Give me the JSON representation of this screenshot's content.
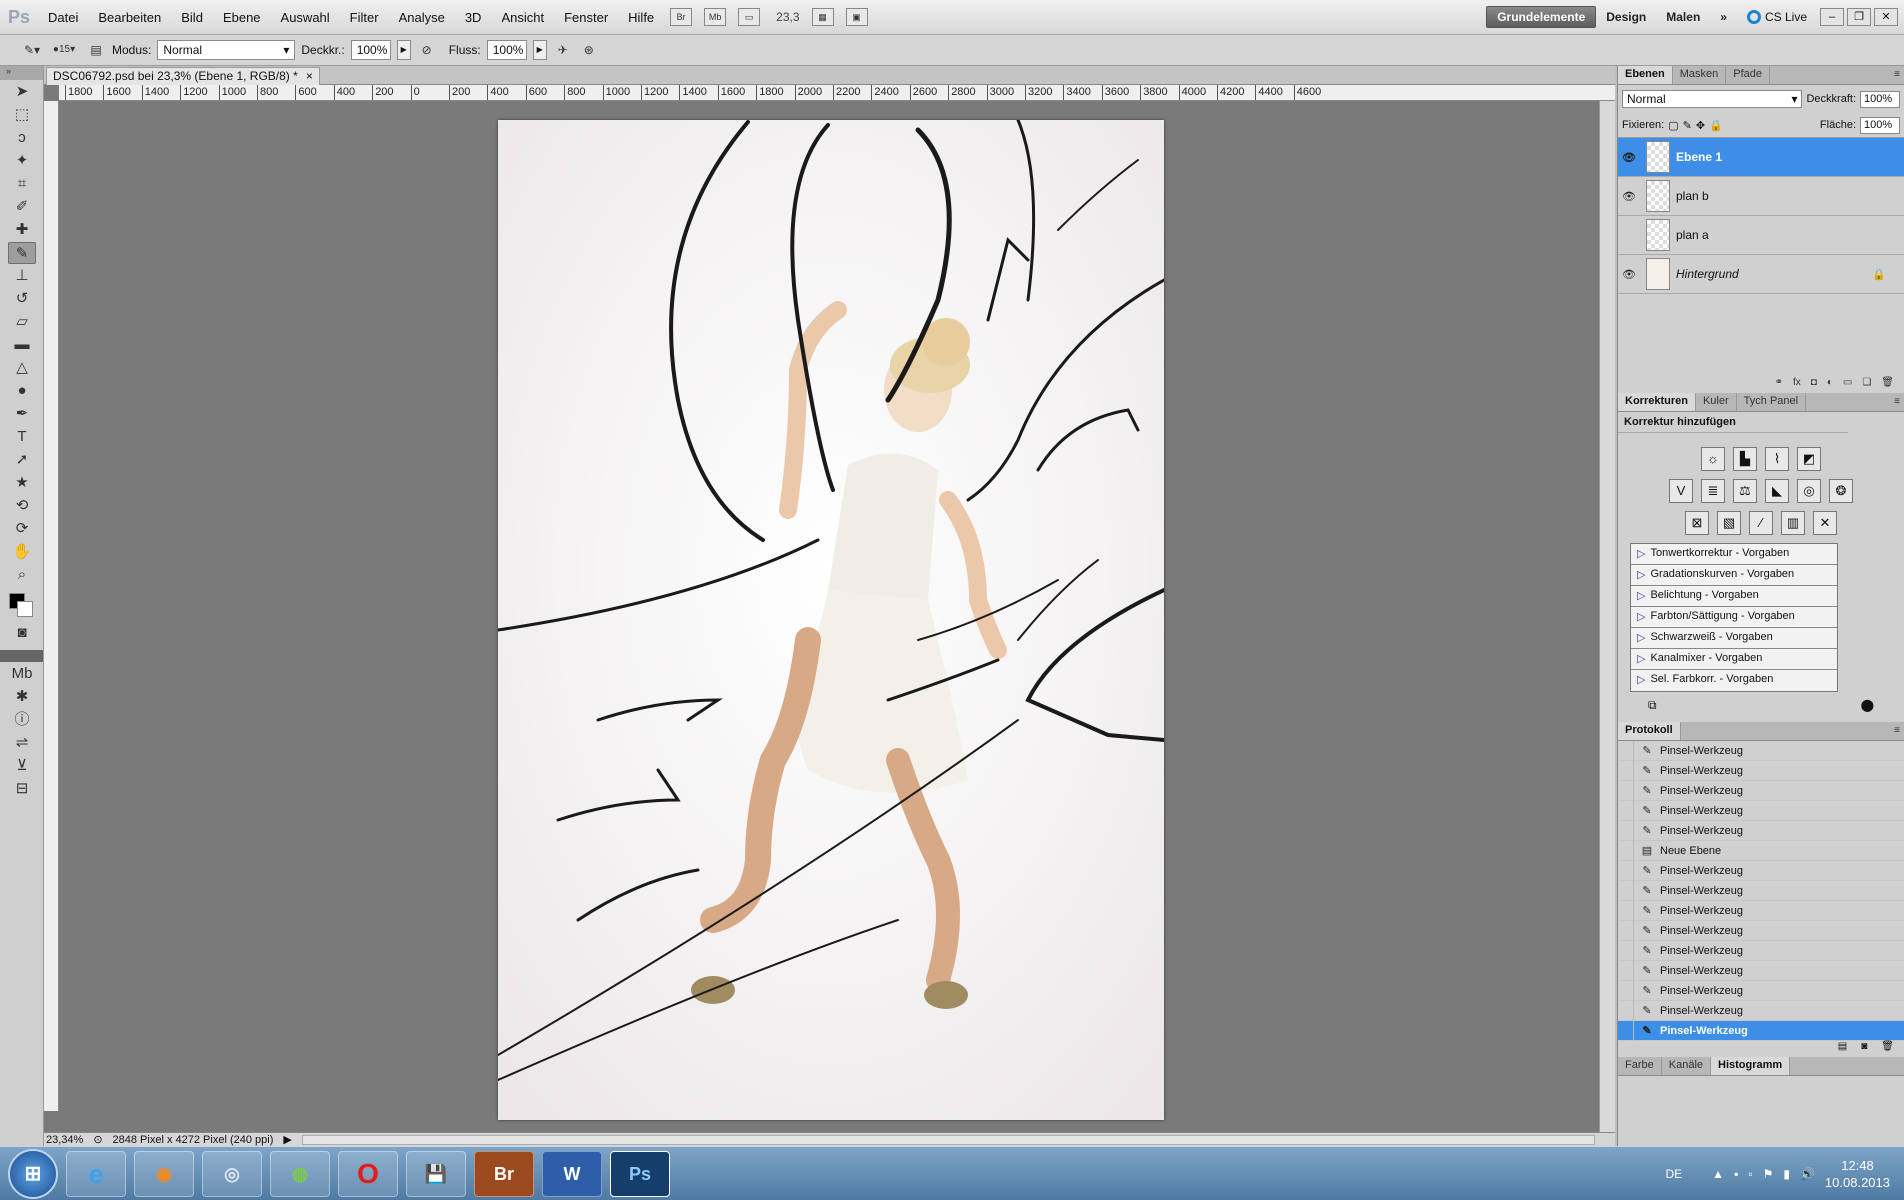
{
  "menubar": {
    "items": [
      "Datei",
      "Bearbeiten",
      "Bild",
      "Ebene",
      "Auswahl",
      "Filter",
      "Analyse",
      "3D",
      "Ansicht",
      "Fenster",
      "Hilfe"
    ],
    "br": "Br",
    "mb": "Mb",
    "zoom": "23,3",
    "workspaces": [
      "Grundelemente",
      "Design",
      "Malen"
    ],
    "more": "»",
    "cslive": "CS Live"
  },
  "options": {
    "brush_size": "15",
    "mode_label": "Modus:",
    "mode_value": "Normal",
    "opacity_label": "Deckkr.:",
    "opacity_value": "100%",
    "flow_label": "Fluss:",
    "flow_value": "100%"
  },
  "document": {
    "tab_title": "DSC06792.psd bei 23,3% (Ebene 1, RGB/8) *",
    "close": "×",
    "ruler_ticks": [
      "1800",
      "1600",
      "1400",
      "1200",
      "1000",
      "800",
      "600",
      "400",
      "200",
      "0",
      "200",
      "400",
      "600",
      "800",
      "1000",
      "1200",
      "1400",
      "1600",
      "1800",
      "2000",
      "2200",
      "2400",
      "2600",
      "2800",
      "3000",
      "3200",
      "3400",
      "3600",
      "3800",
      "4000",
      "4200",
      "4400",
      "4600"
    ],
    "status_zoom": "23,34%",
    "status_info": "2848 Pixel x 4272 Pixel (240 ppi)"
  },
  "layers_panel": {
    "tabs": [
      "Ebenen",
      "Masken",
      "Pfade"
    ],
    "blend_mode": "Normal",
    "opacity_label": "Deckkraft:",
    "opacity_value": "100%",
    "lock_label": "Fixieren:",
    "fill_label": "Fläche:",
    "fill_value": "100%",
    "layers": [
      {
        "name": "Ebene 1",
        "visible": true,
        "active": true
      },
      {
        "name": "plan b",
        "visible": true,
        "active": false
      },
      {
        "name": "plan a",
        "visible": false,
        "active": false
      },
      {
        "name": "Hintergrund",
        "visible": true,
        "active": false,
        "locked": true
      }
    ]
  },
  "adjustments_panel": {
    "tabs": [
      "Korrekturen",
      "Kuler",
      "Tych Panel"
    ],
    "heading": "Korrektur hinzufügen",
    "presets": [
      "Tonwertkorrektur - Vorgaben",
      "Gradationskurven - Vorgaben",
      "Belichtung - Vorgaben",
      "Farbton/Sättigung - Vorgaben",
      "Schwarzweiß - Vorgaben",
      "Kanalmixer - Vorgaben",
      "Sel. Farbkorr. - Vorgaben"
    ]
  },
  "history_panel": {
    "tab": "Protokoll",
    "items": [
      "Pinsel-Werkzeug",
      "Pinsel-Werkzeug",
      "Pinsel-Werkzeug",
      "Pinsel-Werkzeug",
      "Pinsel-Werkzeug",
      "Neue Ebene",
      "Pinsel-Werkzeug",
      "Pinsel-Werkzeug",
      "Pinsel-Werkzeug",
      "Pinsel-Werkzeug",
      "Pinsel-Werkzeug",
      "Pinsel-Werkzeug",
      "Pinsel-Werkzeug",
      "Pinsel-Werkzeug",
      "Pinsel-Werkzeug"
    ],
    "active_index": 14
  },
  "bottom_tabs": [
    "Farbe",
    "Kanäle",
    "Histogramm"
  ],
  "taskbar": {
    "start": "⊞",
    "apps": [
      "e",
      "◉",
      "◎",
      "◍",
      "O",
      "💾",
      "Br",
      "W",
      "Ps"
    ],
    "lang": "DE",
    "time": "12:48",
    "date": "10.08.2013"
  },
  "colors": {
    "accent": "#3d8ee6",
    "canvas_bg": "#7a7a7a"
  }
}
